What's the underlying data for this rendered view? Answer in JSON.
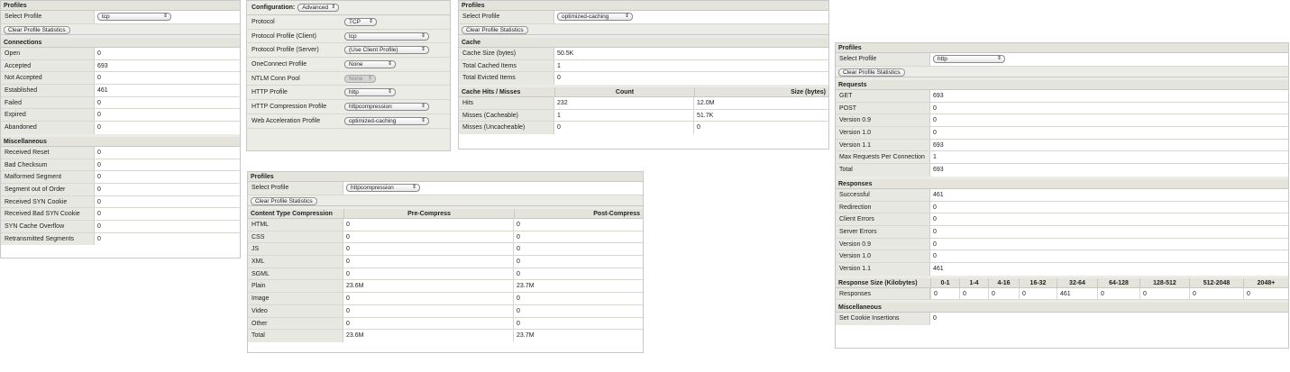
{
  "p1": {
    "header": "Profiles",
    "select_label": "Select Profile",
    "select_value": "tcp",
    "clear_button": "Clear Profile Statistics",
    "connections_title": "Connections",
    "connections": [
      {
        "label": "Open",
        "value": "0"
      },
      {
        "label": "Accepted",
        "value": "693"
      },
      {
        "label": "Not Accepted",
        "value": "0"
      },
      {
        "label": "Established",
        "value": "461"
      },
      {
        "label": "Failed",
        "value": "0"
      },
      {
        "label": "Expired",
        "value": "0"
      },
      {
        "label": "Abandoned",
        "value": "0"
      }
    ],
    "misc_title": "Miscellaneous",
    "misc": [
      {
        "label": "Received Reset",
        "value": "0"
      },
      {
        "label": "Bad Checksum",
        "value": "0"
      },
      {
        "label": "Malformed Segment",
        "value": "0"
      },
      {
        "label": "Segment out of Order",
        "value": "0"
      },
      {
        "label": "Received SYN Cookie",
        "value": "0"
      },
      {
        "label": "Received Bad SYN Cookie",
        "value": "0"
      },
      {
        "label": "SYN Cache Overflow",
        "value": "0"
      },
      {
        "label": "Retransmitted Segments",
        "value": "0"
      }
    ]
  },
  "p2": {
    "config_label": "Configuration:",
    "config_value": "Advanced",
    "rows": [
      {
        "label": "Protocol",
        "value": "TCP"
      },
      {
        "label": "Protocol Profile (Client)",
        "value": "tcp"
      },
      {
        "label": "Protocol Profile (Server)",
        "value": "(Use Client Profile)"
      },
      {
        "label": "OneConnect Profile",
        "value": "None"
      },
      {
        "label": "NTLM Conn Pool",
        "value": "None"
      },
      {
        "label": "HTTP Profile",
        "value": "http"
      },
      {
        "label": "HTTP Compression Profile",
        "value": "httpcompression"
      },
      {
        "label": "Web Acceleration Profile",
        "value": "optimized-caching"
      }
    ]
  },
  "p3": {
    "header": "Profiles",
    "select_label": "Select Profile",
    "select_value": "optimized-caching",
    "clear_button": "Clear Profile Statistics",
    "cache_title": "Cache",
    "cache": [
      {
        "label": "Cache Size (bytes)",
        "value": "50.5K"
      },
      {
        "label": "Total Cached Items",
        "value": "1"
      },
      {
        "label": "Total Evicted Items",
        "value": "0"
      }
    ],
    "hits_title": "Cache Hits / Misses",
    "hits_col_count": "Count",
    "hits_col_size": "Size (bytes)",
    "hits": [
      {
        "label": "Hits",
        "count": "232",
        "size": "12.0M"
      },
      {
        "label": "Misses (Cacheable)",
        "count": "1",
        "size": "51.7K"
      },
      {
        "label": "Misses (Uncacheable)",
        "count": "0",
        "size": "0"
      }
    ]
  },
  "p4": {
    "header": "Profiles",
    "select_label": "Select Profile",
    "select_value": "httpcompression",
    "clear_button": "Clear Profile Statistics",
    "table_title": "Content Type Compression",
    "col_pre": "Pre-Compress",
    "col_post": "Post-Compress",
    "rows": [
      {
        "label": "HTML",
        "pre": "0",
        "post": "0"
      },
      {
        "label": "CSS",
        "pre": "0",
        "post": "0"
      },
      {
        "label": "JS",
        "pre": "0",
        "post": "0"
      },
      {
        "label": "XML",
        "pre": "0",
        "post": "0"
      },
      {
        "label": "SGML",
        "pre": "0",
        "post": "0"
      },
      {
        "label": "Plain",
        "pre": "23.6M",
        "post": "23.7M"
      },
      {
        "label": "Image",
        "pre": "0",
        "post": "0"
      },
      {
        "label": "Video",
        "pre": "0",
        "post": "0"
      },
      {
        "label": "Other",
        "pre": "0",
        "post": "0"
      },
      {
        "label": "Total",
        "pre": "23.6M",
        "post": "23.7M"
      }
    ]
  },
  "p5": {
    "header": "Profiles",
    "select_label": "Select Profile",
    "select_value": "http",
    "clear_button": "Clear Profile Statistics",
    "requests_title": "Requests",
    "requests": [
      {
        "label": "GET",
        "value": "693"
      },
      {
        "label": "POST",
        "value": "0"
      },
      {
        "label": "Version 0.9",
        "value": "0"
      },
      {
        "label": "Version 1.0",
        "value": "0"
      },
      {
        "label": "Version 1.1",
        "value": "693"
      },
      {
        "label": "Max Requests Per Connection",
        "value": "1"
      },
      {
        "label": "Total",
        "value": "693"
      }
    ],
    "responses_title": "Responses",
    "responses": [
      {
        "label": "Successful",
        "value": "461"
      },
      {
        "label": "Redirection",
        "value": "0"
      },
      {
        "label": "Client Errors",
        "value": "0"
      },
      {
        "label": "Server Errors",
        "value": "0"
      },
      {
        "label": "Version 0.9",
        "value": "0"
      },
      {
        "label": "Version 1.0",
        "value": "0"
      },
      {
        "label": "Version 1.1",
        "value": "461"
      }
    ],
    "size_title": "Response Size (Kilobytes)",
    "size_cols": [
      "0-1",
      "1-4",
      "4-16",
      "16-32",
      "32-64",
      "64-128",
      "128-512",
      "512-2048",
      "2048+"
    ],
    "size_row_label": "Responses",
    "size_values": [
      "0",
      "0",
      "0",
      "0",
      "461",
      "0",
      "0",
      "0",
      "0"
    ],
    "misc_title": "Miscellaneous",
    "misc": [
      {
        "label": "Set Cookie Insertions",
        "value": "0"
      }
    ]
  }
}
